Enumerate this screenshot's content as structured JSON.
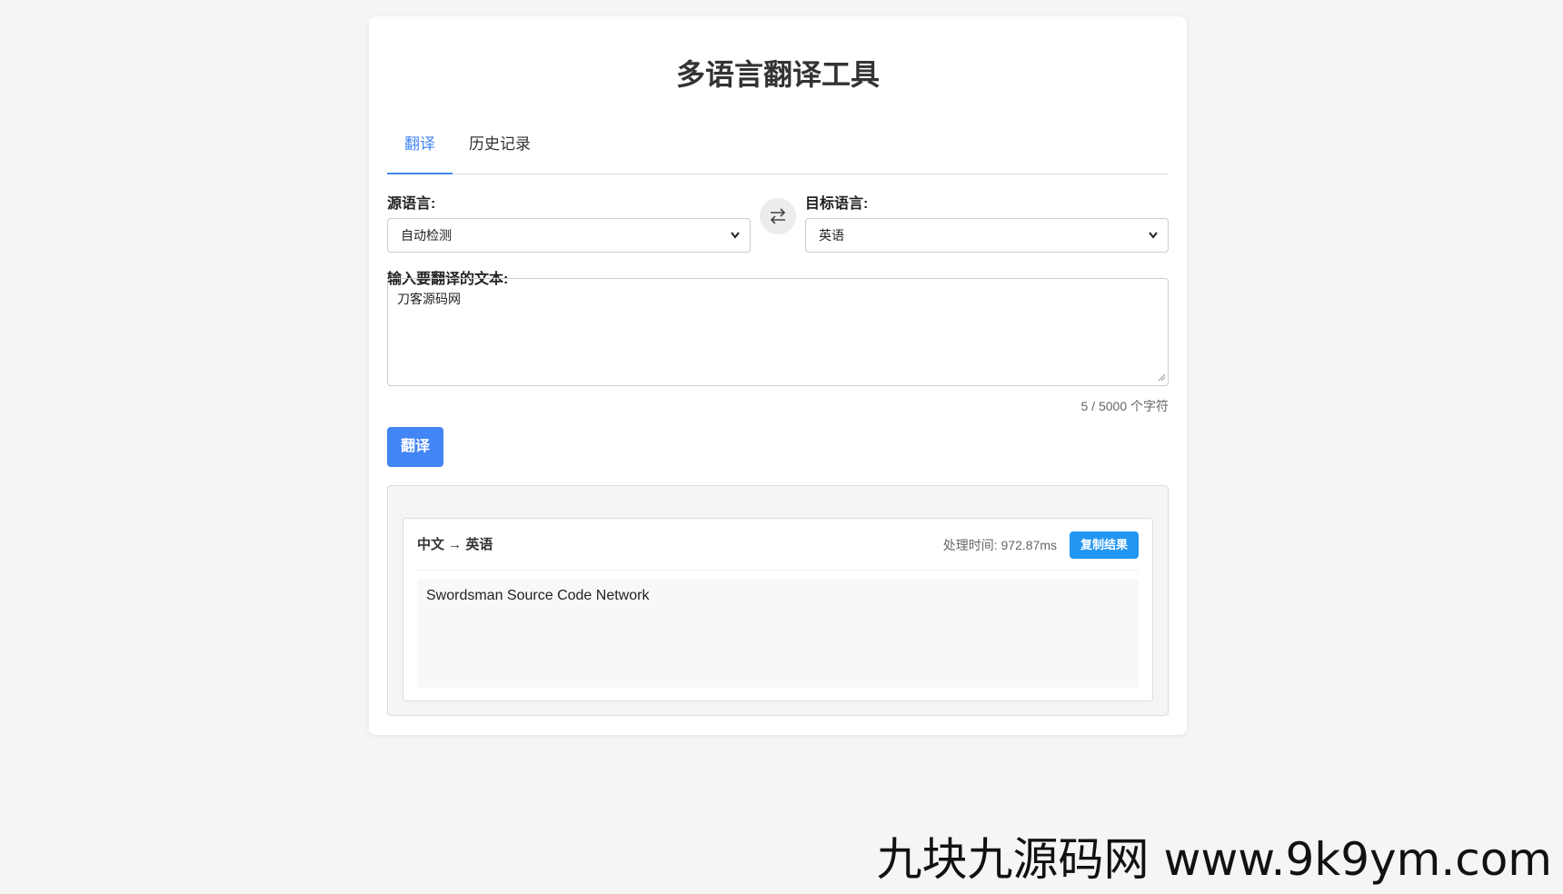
{
  "app": {
    "title": "多语言翻译工具"
  },
  "tabs": [
    {
      "label": "翻译",
      "active": true
    },
    {
      "label": "历史记录",
      "active": false
    }
  ],
  "source": {
    "label": "源语言:",
    "selected": "自动检测"
  },
  "target": {
    "label": "目标语言:",
    "selected": "英语"
  },
  "swap_icon": "swap-arrows-icon",
  "input": {
    "label": "输入要翻译的文本:",
    "value": "刀客源码网",
    "char_count": "5 / 5000 个字符"
  },
  "translate_button": "翻译",
  "result": {
    "lang_pair": "中文 → 英语",
    "processing_time": "处理时间: 972.87ms",
    "copy_button": "复制结果",
    "text": "Swordsman Source Code Network"
  },
  "colors": {
    "accent": "#4285f4",
    "copy": "#2196f3",
    "background": "#f5f5f5"
  },
  "watermark": "九块九源码网 www.9k9ym.com"
}
